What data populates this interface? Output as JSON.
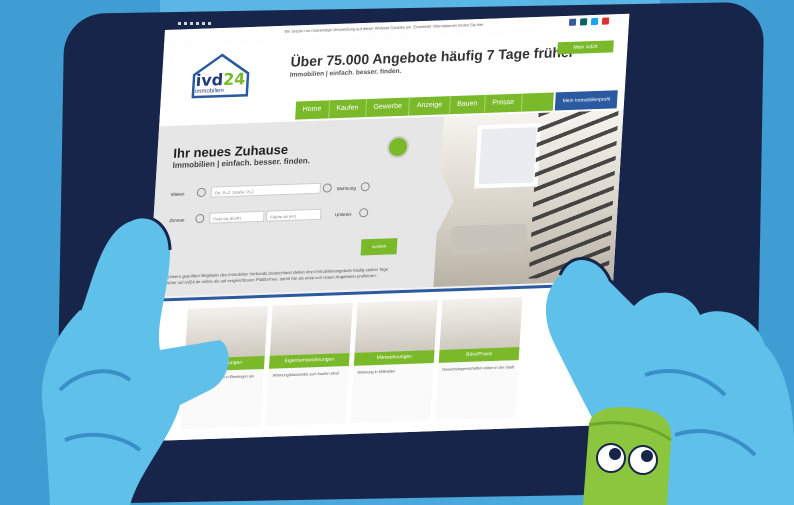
{
  "colors": {
    "background": "#4aa8dc",
    "tablet": "#17254a",
    "brand_green": "#7ab929",
    "brand_blue": "#2b5aa0"
  },
  "topbar": {
    "notice": "Wir setzen nur notwendige Verwendung auf dieser Website Cookies ein. Erweiterte Informationen finden Sie hier."
  },
  "logo": {
    "text_main": "ivd",
    "text_num": "24",
    "text_sub": "immobilien"
  },
  "header": {
    "headline": "Über 75.000 Angebote häufig 7 Tage früher*",
    "subline": "Immobilien | einfach. besser. finden.",
    "account_button": "Mein ivd24",
    "nav": [
      "Home",
      "Kaufen",
      "Gewerbe",
      "Anzeige",
      "Bauen",
      "Presse"
    ],
    "nav_button": "Mein Immobilienprofil"
  },
  "hero": {
    "title": "Ihr neues Zuhause",
    "subtitle": "Immobilien | einfach. besser. finden.",
    "label_mieten": "Mieten",
    "placeholder_ort": "Ort, PLZ, Straße, PLZ",
    "label_wohnung": "Wohnung",
    "label_zimmer": "Zimmer",
    "placeholder_preis": "Preis bis (EUR)",
    "placeholder_flaeche": "Fläche ab (m²)",
    "label_umkreis": "Umkreis",
    "search_button": "suchen",
    "footnote": "*Unsere geprüften Mitglieder des Immobilien Verbands Deutschland stellen ihre Immobilienangebote häufig sieben Tage früher auf ivd24.de online als auf vergleichbaren Plattformen, damit Sie als erste von neuen Angeboten profitieren."
  },
  "cards": [
    {
      "label": "Mietwohnungen",
      "desc": "Mietwohnung Neubau in Eberlingen am Bodensee"
    },
    {
      "label": "Eigentumswohnungen",
      "desc": "Wohnung/Maisonette zum Kaufen ideal"
    },
    {
      "label": "Mietwohnungen",
      "desc": "Wohnung in Mittelalter"
    },
    {
      "label": "Büro/Praxis",
      "desc": "Gewerbeliegenschaften mitten in der Stadt"
    }
  ],
  "nav_arrow": "‹"
}
